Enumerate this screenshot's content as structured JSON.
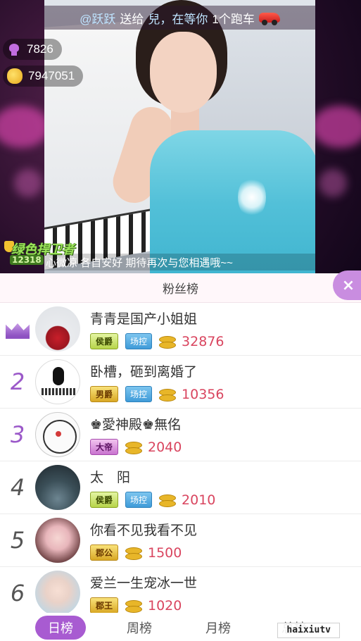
{
  "stream": {
    "gift_banner": {
      "user": "@跃跃",
      "action": "送给",
      "target": "兒，在等你",
      "gift": "1个跑车",
      "gift_icon": "sports-car-icon"
    },
    "flowers": {
      "icon": "flower-icon",
      "value": "7826"
    },
    "coins": {
      "icon": "coin-bag-icon",
      "value": "7947051"
    },
    "caption": "心微凉 各自安好 期待再次与您相遇哦~~",
    "logo": {
      "brand": "绿色捍卫者",
      "number": "12318"
    }
  },
  "panel": {
    "title": "粉丝榜",
    "close_icon": "close-icon",
    "close_label": "×",
    "accent": "#a85bd1"
  },
  "ranking": [
    {
      "rank": "",
      "rank_icon": "crown-icon",
      "name": "青青是国产小姐姐",
      "noble": "侯爵",
      "admin": "场控",
      "amount": "32876"
    },
    {
      "rank": "2",
      "name": "卧槽，砸到离婚了",
      "noble": "男爵",
      "admin": "场控",
      "amount": "10356"
    },
    {
      "rank": "3",
      "name": "♚愛神殿♚無佲",
      "noble": "大帝",
      "admin": "",
      "amount": "2040"
    },
    {
      "rank": "4",
      "name": "太　阳",
      "noble": "侯爵",
      "admin": "场控",
      "amount": "2010"
    },
    {
      "rank": "5",
      "name": "你看不见我看不见",
      "noble": "郡公",
      "admin": "",
      "amount": "1500"
    },
    {
      "rank": "6",
      "name": "爱兰一生宠冰一世",
      "noble": "郡王",
      "admin": "",
      "amount": "1020"
    }
  ],
  "tabs": [
    {
      "label": "日榜",
      "active": true
    },
    {
      "label": "周榜",
      "active": false
    },
    {
      "label": "月榜",
      "active": false
    },
    {
      "label": "总榜",
      "active": false
    }
  ],
  "watermark": "haixiutv"
}
